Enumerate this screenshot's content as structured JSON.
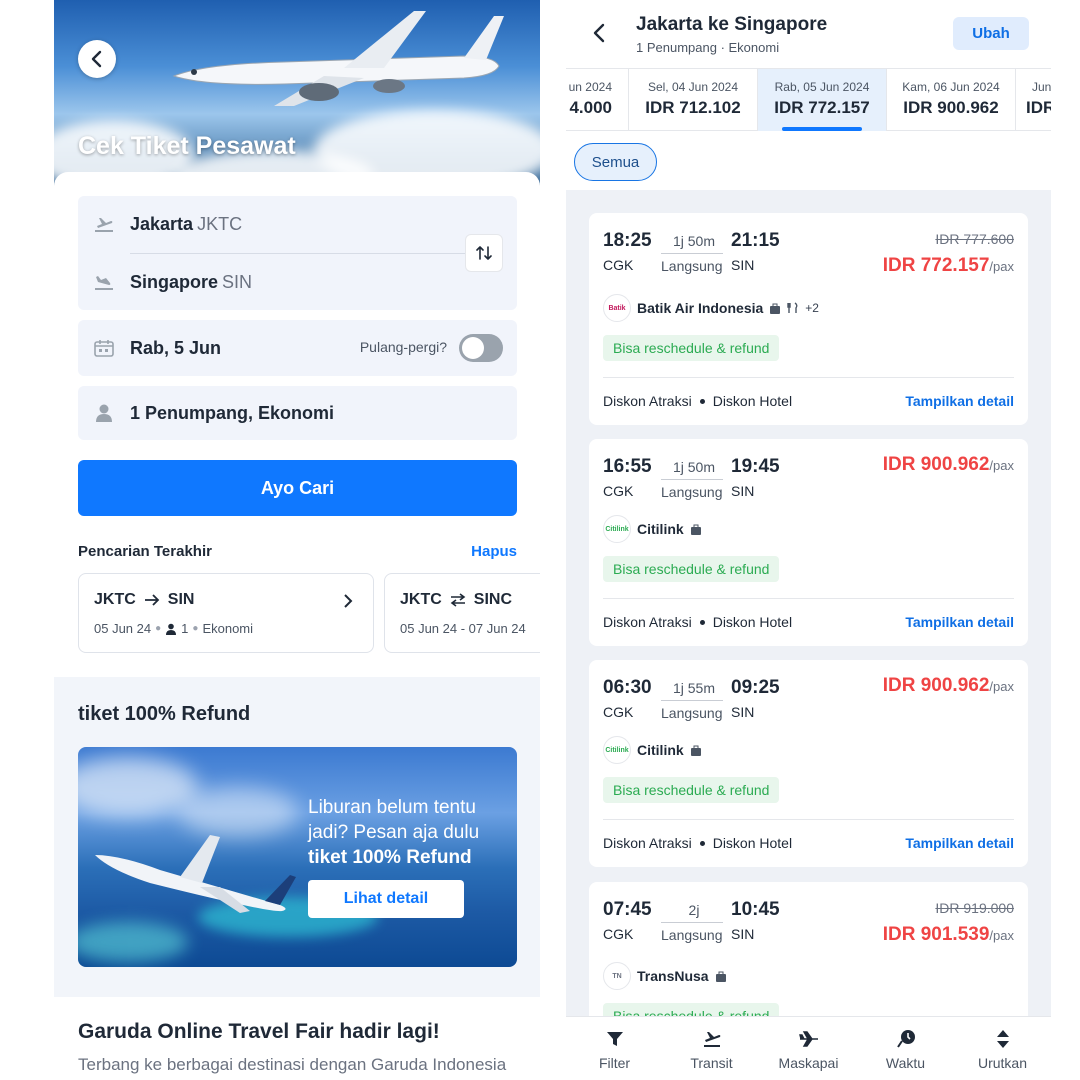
{
  "left": {
    "hero": {
      "title": "Cek Tiket Pesawat"
    },
    "form": {
      "origin": {
        "city": "Jakarta",
        "code": "JKTC"
      },
      "destination": {
        "city": "Singapore",
        "code": "SIN"
      },
      "date": "Rab, 5 Jun",
      "round_trip_label": "Pulang-pergi?",
      "passengers": "1 Penumpang, Ekonomi",
      "search_button": "Ayo Cari"
    },
    "recent": {
      "title": "Pencarian Terakhir",
      "clear_label": "Hapus",
      "items": [
        {
          "from": "JKTC",
          "to": "SIN",
          "date": "05 Jun 24",
          "pax": "1",
          "class": "Ekonomi"
        },
        {
          "from": "JKTC",
          "to": "SINC",
          "date": "05 Jun 24 - 07 Jun 24"
        }
      ]
    },
    "promo": {
      "title": "tiket 100% Refund",
      "line1": "Liburan belum tentu",
      "line2": "jadi? Pesan aja dulu",
      "line3": "tiket 100% Refund",
      "button": "Lihat detail"
    },
    "garuda": {
      "title": "Garuda Online Travel Fair hadir lagi!",
      "subtitle": "Terbang ke berbagai destinasi dengan Garuda Indonesia"
    }
  },
  "right": {
    "header": {
      "title": "Jakarta ke Singapore",
      "subtitle": "1 Penumpang · Ekonomi",
      "edit_button": "Ubah"
    },
    "dates": [
      {
        "label": "un 2024",
        "price": "4.000"
      },
      {
        "label": "Sel, 04 Jun 2024",
        "price": "IDR 712.102"
      },
      {
        "label": "Rab, 05 Jun 2024",
        "price": "IDR 772.157",
        "active": true
      },
      {
        "label": "Kam, 06 Jun 2024",
        "price": "IDR 900.962"
      },
      {
        "label": "Jun",
        "price": "IDR"
      }
    ],
    "filter_chip": "Semua",
    "flights": [
      {
        "dep": "18:25",
        "arr": "21:15",
        "duration": "1j 50m",
        "type": "Langsung",
        "orig": "CGK",
        "dest": "SIN",
        "old_price": "IDR 777.600",
        "price": "IDR 772.157",
        "per": "/pax",
        "airline": "Batik Air Indonesia",
        "extra": "+2",
        "badge": "Bisa reschedule & refund",
        "promo1": "Diskon Atraksi",
        "promo2": "Diskon Hotel",
        "detail": "Tampilkan detail"
      },
      {
        "dep": "16:55",
        "arr": "19:45",
        "duration": "1j 50m",
        "type": "Langsung",
        "orig": "CGK",
        "dest": "SIN",
        "price": "IDR 900.962",
        "per": "/pax",
        "airline": "Citilink",
        "badge": "Bisa reschedule & refund",
        "promo1": "Diskon Atraksi",
        "promo2": "Diskon Hotel",
        "detail": "Tampilkan detail"
      },
      {
        "dep": "06:30",
        "arr": "09:25",
        "duration": "1j 55m",
        "type": "Langsung",
        "orig": "CGK",
        "dest": "SIN",
        "price": "IDR 900.962",
        "per": "/pax",
        "airline": "Citilink",
        "badge": "Bisa reschedule & refund",
        "promo1": "Diskon Atraksi",
        "promo2": "Diskon Hotel",
        "detail": "Tampilkan detail"
      },
      {
        "dep": "07:45",
        "arr": "10:45",
        "duration": "2j",
        "type": "Langsung",
        "orig": "CGK",
        "dest": "SIN",
        "old_price": "IDR 919.000",
        "price": "IDR 901.539",
        "per": "/pax",
        "airline": "TransNusa",
        "badge": "Bisa reschedule & refund"
      }
    ],
    "bottom_nav": [
      "Filter",
      "Transit",
      "Maskapai",
      "Waktu",
      "Urutkan"
    ]
  }
}
